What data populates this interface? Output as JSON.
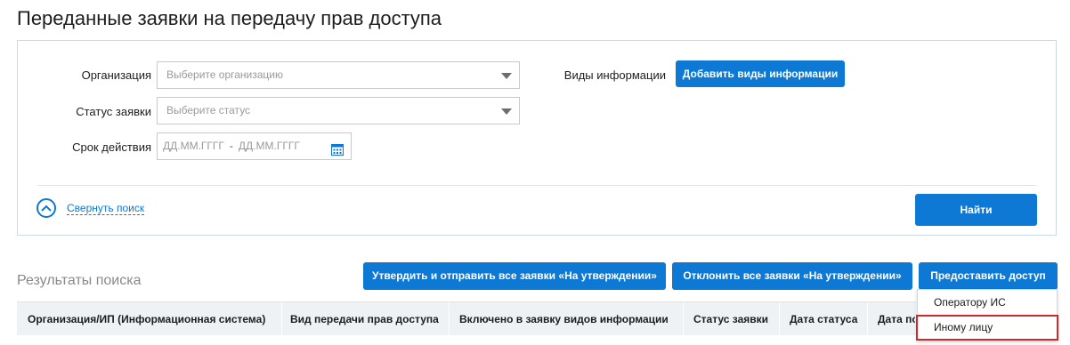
{
  "page": {
    "title": "Переданные заявки на передачу прав доступа"
  },
  "filters": {
    "organization_label": "Организация",
    "organization_placeholder": "Выберите организацию",
    "status_label": "Статус заявки",
    "status_placeholder": "Выберите статус",
    "period_label": "Срок действия",
    "date_from_placeholder": "ДД.ММ.ГГГГ",
    "date_separator": "-",
    "date_to_placeholder": "ДД.ММ.ГГГГ",
    "info_types_label": "Виды информации",
    "add_info_types_button": "Добавить виды информации",
    "collapse_link": "Свернуть поиск",
    "find_button": "Найти"
  },
  "results": {
    "title": "Результаты поиска",
    "approve_all_button": "Утвердить и отправить все заявки «На утверждении»",
    "reject_all_button": "Отклонить все заявки «На утверждении»",
    "grant_access_button": "Предоставить доступ",
    "columns": [
      "Организация/ИП (Информационная система)",
      "Вид передачи прав доступа",
      "Включено в заявку видов информации",
      "Статус заявки",
      "Дата статуса",
      "Дата по"
    ]
  },
  "grant_menu": {
    "items": [
      "Оператору ИС",
      "Иному лицу"
    ],
    "highlighted_item": "Иному лицу"
  },
  "colors": {
    "accent": "#0d79d4",
    "highlight_border": "#d42828",
    "table_header_bg": "#eef2f5"
  }
}
